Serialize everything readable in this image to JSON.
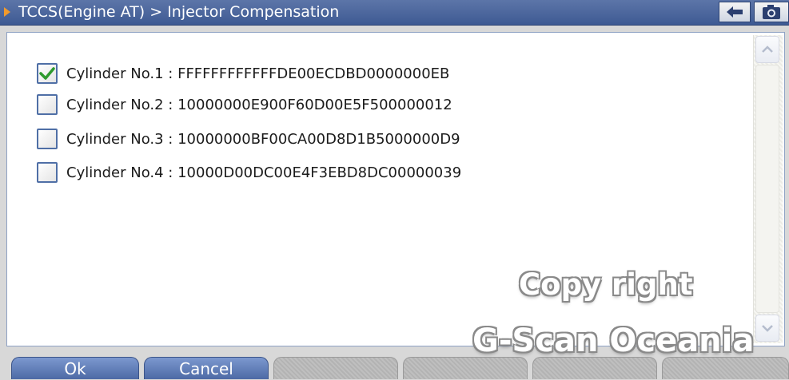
{
  "title_bar": {
    "text": "TCCS(Engine AT) > Injector Compensation",
    "arrow_icon": "play-arrow-icon",
    "back_icon": "back-arrow-icon",
    "camera_icon": "camera-icon"
  },
  "cylinders": [
    {
      "label": "Cylinder No.1 : FFFFFFFFFFFFDE00ECDBD0000000EB",
      "checked": true
    },
    {
      "label": "Cylinder No.2 : 10000000E900F60D00E5F500000012",
      "checked": false
    },
    {
      "label": "Cylinder No.3 : 10000000BF00CA00D8D1B5000000D9",
      "checked": false
    },
    {
      "label": "Cylinder No.4 : 10000D00DC00E4F3EBD8DC00000039",
      "checked": false
    }
  ],
  "watermark": {
    "line1": "Copy right",
    "line2": "G-Scan Oceania"
  },
  "buttons": {
    "ok": "Ok",
    "cancel": "Cancel"
  },
  "colors": {
    "accent": "#3e5a93",
    "check": "#2e9a2e",
    "arrow": "#f29a2c"
  }
}
